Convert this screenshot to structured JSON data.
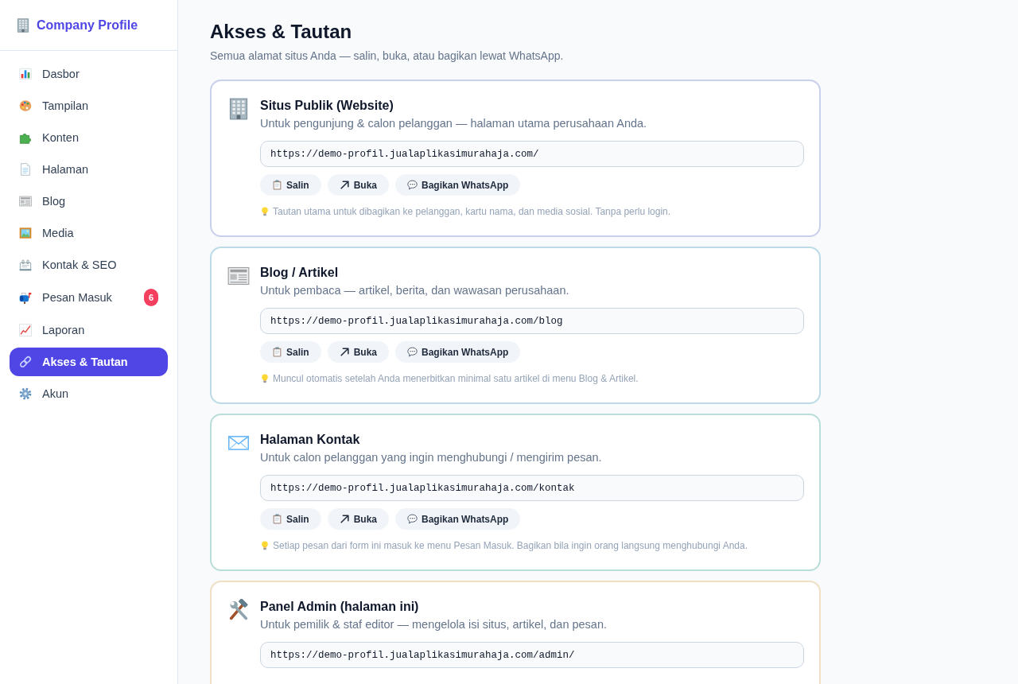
{
  "sidebar": {
    "brand": "Company Profile",
    "items": [
      {
        "label": "Dasbor",
        "selected": false
      },
      {
        "label": "Tampilan",
        "selected": false
      },
      {
        "label": "Konten",
        "selected": false
      },
      {
        "label": "Halaman",
        "selected": false
      },
      {
        "label": "Blog",
        "selected": false
      },
      {
        "label": "Media",
        "selected": false
      },
      {
        "label": "Kontak & SEO",
        "selected": false
      },
      {
        "label": "Pesan Masuk",
        "selected": false,
        "badge": "6"
      },
      {
        "label": "Laporan",
        "selected": false
      },
      {
        "label": "Akses & Tautan",
        "selected": true
      },
      {
        "label": "Akun",
        "selected": false
      }
    ]
  },
  "page": {
    "title": "Akses & Tautan",
    "subtitle": "Semua alamat situs Anda — salin, buka, atau bagikan lewat WhatsApp."
  },
  "cards": [
    {
      "title": "Situs Publik (Website)",
      "description": "Untuk pengunjung & calon pelanggan — halaman utama perusahaan Anda.",
      "url": "https://demo-profil.jualaplikasimurahaja.com/",
      "actions": [
        "Salin",
        "Buka",
        "Bagikan WhatsApp"
      ],
      "note": "Tautan utama untuk dibagikan ke pelanggan, kartu nama, dan media sosial. Tanpa perlu login.",
      "color": "#c9d0ec"
    },
    {
      "title": "Blog / Artikel",
      "description": "Untuk pembaca — artikel, berita, dan wawasan perusahaan.",
      "url": "https://demo-profil.jualaplikasimurahaja.com/blog",
      "actions": [
        "Salin",
        "Buka",
        "Bagikan WhatsApp"
      ],
      "note": "Muncul otomatis setelah Anda menerbitkan minimal satu artikel di menu Blog & Artikel.",
      "color": "#bcdbe6"
    },
    {
      "title": "Halaman Kontak",
      "description": "Untuk calon pelanggan yang ingin menghubungi / mengirim pesan.",
      "url": "https://demo-profil.jualaplikasimurahaja.com/kontak",
      "actions": [
        "Salin",
        "Buka",
        "Bagikan WhatsApp"
      ],
      "note": "Setiap pesan dari form ini masuk ke menu Pesan Masuk. Bagikan bila ingin orang langsung menghubungi Anda.",
      "color": "#b9ddd8"
    },
    {
      "title": "Panel Admin (halaman ini)",
      "description": "Untuk pemilik & staf editor — mengelola isi situs, artikel, dan pesan.",
      "url": "https://demo-profil.jualaplikasimurahaja.com/admin/",
      "color": "#efdfc4"
    }
  ]
}
